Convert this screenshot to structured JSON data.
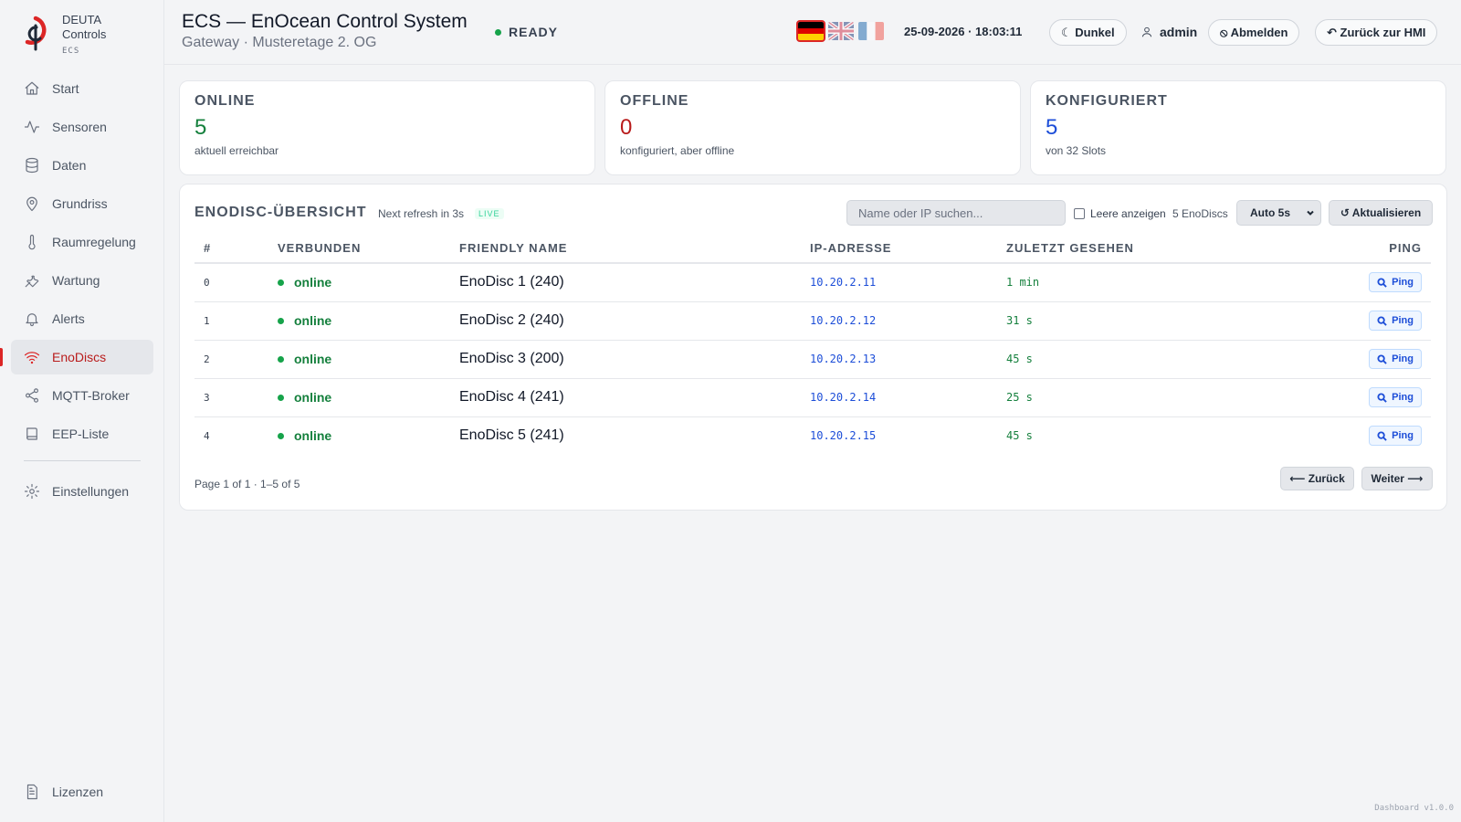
{
  "brand": {
    "name": "DEUTA",
    "sub": "Controls",
    "tag": "ECS"
  },
  "sidebar": {
    "items": [
      {
        "label": "Start",
        "icon": "home-icon"
      },
      {
        "label": "Sensoren",
        "icon": "activity-icon"
      },
      {
        "label": "Daten",
        "icon": "database-icon"
      },
      {
        "label": "Grundriss",
        "icon": "map-pin-icon"
      },
      {
        "label": "Raumregelung",
        "icon": "thermometer-icon"
      },
      {
        "label": "Wartung",
        "icon": "wrench-icon"
      },
      {
        "label": "Alerts",
        "icon": "bell-icon"
      },
      {
        "label": "EnoDiscs",
        "icon": "wifi-icon",
        "active": true
      },
      {
        "label": "MQTT-Broker",
        "icon": "share-icon"
      },
      {
        "label": "EEP-Liste",
        "icon": "book-icon"
      },
      {
        "label": "Einstellungen",
        "icon": "gear-icon"
      }
    ],
    "bottom": {
      "label": "Lizenzen",
      "icon": "file-text-icon"
    }
  },
  "header": {
    "title": "ECS — EnOcean Control System",
    "subtitle": "Gateway · Musteretage 2. OG",
    "status": "READY",
    "datetime": "25-09-2026 · 18:03:11",
    "theme_btn": "☾ Dunkel",
    "user": "admin",
    "logout_btn": "⦸ Abmelden",
    "back_btn": "↶ Zurück zur HMI",
    "languages": [
      "de",
      "en",
      "fr"
    ],
    "active_language": "de"
  },
  "kpis": [
    {
      "title": "ONLINE",
      "value": "5",
      "desc": "aktuell erreichbar",
      "color": "#15803d"
    },
    {
      "title": "OFFLINE",
      "value": "0",
      "desc": "konfiguriert, aber offline",
      "color": "#b91c1c"
    },
    {
      "title": "KONFIGURIERT",
      "value": "5",
      "desc": "von 32 Slots",
      "color": "#1d4ed8"
    }
  ],
  "panel": {
    "title": "ENODISC-ÜBERSICHT",
    "refresh": "Next refresh in 3s",
    "live": "LIVE",
    "search_placeholder": "Name oder IP suchen...",
    "show_empty": "Leere anzeigen",
    "count": "5 EnoDiscs",
    "interval": "Auto 5s",
    "refresh_btn": "↺ Aktualisieren",
    "columns": [
      "#",
      "VERBUNDEN",
      "FRIENDLY NAME",
      "IP-ADRESSE",
      "ZULETZT GESEHEN",
      "PING"
    ],
    "rows": [
      {
        "idx": "0",
        "status": "online",
        "name": "EnoDisc 1 (240)",
        "ip": "10.20.2.11",
        "seen": "1 min",
        "ping": "Ping"
      },
      {
        "idx": "1",
        "status": "online",
        "name": "EnoDisc 2 (240)",
        "ip": "10.20.2.12",
        "seen": "31 s",
        "ping": "Ping"
      },
      {
        "idx": "2",
        "status": "online",
        "name": "EnoDisc 3 (200)",
        "ip": "10.20.2.13",
        "seen": "45 s",
        "ping": "Ping"
      },
      {
        "idx": "3",
        "status": "online",
        "name": "EnoDisc 4 (241)",
        "ip": "10.20.2.14",
        "seen": "25 s",
        "ping": "Ping"
      },
      {
        "idx": "4",
        "status": "online",
        "name": "EnoDisc 5 (241)",
        "ip": "10.20.2.15",
        "seen": "45 s",
        "ping": "Ping"
      }
    ],
    "page_info": "Page 1 of 1  ·  1–5 of 5",
    "prev_btn": "⟵ Zurück",
    "next_btn": "Weiter ⟶"
  },
  "footer": {
    "version": "Dashboard v1.0.0"
  },
  "colors": {
    "accent": "#dc2626",
    "online": "#16a34a",
    "ip": "#1d4ed8"
  }
}
